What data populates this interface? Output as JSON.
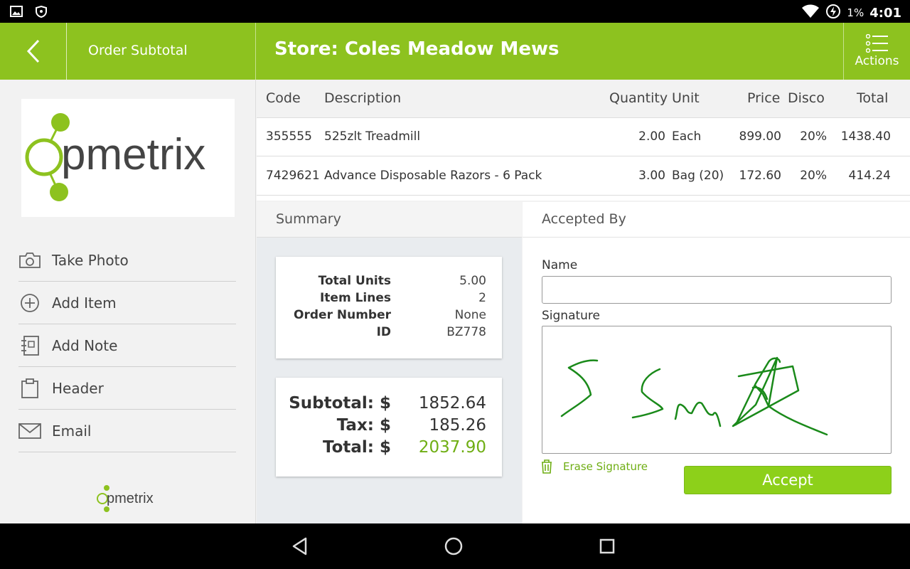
{
  "status_bar": {
    "battery": "1%",
    "time": "4:01"
  },
  "app_bar": {
    "section_title": "Order Subtotal",
    "store_title": "Store: Coles Meadow Mews",
    "actions_label": "Actions"
  },
  "sidebar": {
    "logo_text": "pmetrix",
    "items": [
      {
        "label": "Take Photo",
        "icon": "camera-icon"
      },
      {
        "label": "Add Item",
        "icon": "add-circle-icon"
      },
      {
        "label": "Add Note",
        "icon": "note-icon"
      },
      {
        "label": "Header",
        "icon": "clipboard-icon"
      },
      {
        "label": "Email",
        "icon": "email-icon"
      }
    ],
    "footer_logo_text": "pmetrix"
  },
  "table": {
    "headers": [
      "Code",
      "Description",
      "Quantity",
      "Unit",
      "Price",
      "Disco",
      "Total"
    ],
    "rows": [
      [
        "355555",
        "525zlt Treadmill",
        "2.00",
        "Each",
        "899.00",
        "20%",
        "1438.40"
      ],
      [
        "7429621",
        "Advance Disposable Razors - 6 Pack",
        "3.00",
        "Bag (20)",
        "172.60",
        "20%",
        "414.24"
      ]
    ]
  },
  "summary": {
    "title": "Summary",
    "details": [
      {
        "label": "Total Units",
        "value": "5.00"
      },
      {
        "label": "Item Lines",
        "value": "2"
      },
      {
        "label": "Order Number",
        "value": "None"
      },
      {
        "label": "ID",
        "value": "BZ778"
      }
    ],
    "totals": [
      {
        "label": "Subtotal: $",
        "value": "1852.64"
      },
      {
        "label": "Tax: $",
        "value": "185.26"
      },
      {
        "label": "Total: $",
        "value": "2037.90"
      }
    ]
  },
  "accepted_by": {
    "title": "Accepted By",
    "name_label": "Name",
    "name_value": "",
    "signature_label": "Signature",
    "erase_label": "Erase Signature",
    "accept_label": "Accept"
  },
  "colors": {
    "brand_green": "#8dc21f",
    "accept_green": "#8dd01a",
    "total_green": "#6fae14",
    "signature_ink": "#1a8a1a"
  }
}
